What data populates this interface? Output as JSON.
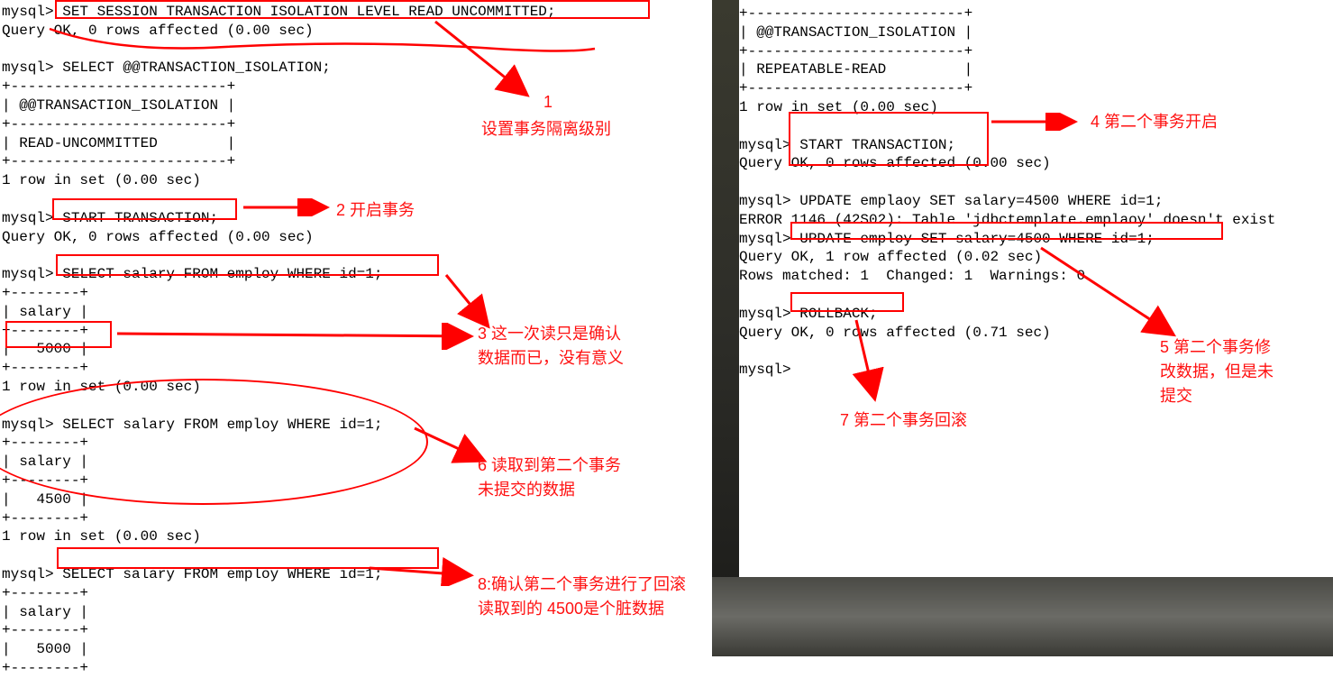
{
  "left": {
    "line1": "mysql> SET SESSION TRANSACTION ISOLATION LEVEL READ UNCOMMITTED;",
    "line2": "Query OK, 0 rows affected (0.00 sec)",
    "blank1": "",
    "line3": "mysql> SELECT @@TRANSACTION_ISOLATION;",
    "sep1": "+-------------------------+",
    "head1": "| @@TRANSACTION_ISOLATION |",
    "sep2": "+-------------------------+",
    "val1": "| READ-UNCOMMITTED        |",
    "sep3": "+-------------------------+",
    "row1": "1 row in set (0.00 sec)",
    "blank2": "",
    "line4": "mysql> START TRANSACTION;",
    "line5": "Query OK, 0 rows affected (0.00 sec)",
    "blank3": "",
    "line6": "mysql> SELECT salary FROM employ WHERE id=1;",
    "sep4": "+--------+",
    "head2": "| salary |",
    "sep5": "+--------+",
    "val2": "|   5000 |",
    "sep6": "+--------+",
    "row2": "1 row in set (0.00 sec)",
    "blank4": "",
    "line7": "mysql> SELECT salary FROM employ WHERE id=1;",
    "sep7": "+--------+",
    "head3": "| salary |",
    "sep8": "+--------+",
    "val3": "|   4500 |",
    "sep9": "+--------+",
    "row3": "1 row in set (0.00 sec)",
    "blank5": "",
    "line8": "mysql> SELECT salary FROM employ WHERE id=1;",
    "sep10": "+--------+",
    "head4": "| salary |",
    "sep11": "+--------+",
    "val4": "|   5000 |",
    "sep12": "+--------+"
  },
  "right": {
    "rtop": "+-------------------------+",
    "rh1": "| @@TRANSACTION_ISOLATION |",
    "rsep1": "+-------------------------+",
    "rv1": "| REPEATABLE-READ         |",
    "rsep2": "+-------------------------+",
    "rrow1": "1 row in set (0.00 sec)",
    "rblank1": "",
    "rline1": "mysql> START TRANSACTION;",
    "rline2": "Query OK, 0 rows affected (0.00 sec)",
    "rblank2": "",
    "rline3": "mysql> UPDATE emplaoy SET salary=4500 WHERE id=1;",
    "rerr": "ERROR 1146 (42S02): Table 'jdbctemplate.emplaoy' doesn't exist",
    "rline4": "mysql> UPDATE employ SET salary=4500 WHERE id=1;",
    "rline5": "Query OK, 1 row affected (0.02 sec)",
    "rline6": "Rows matched: 1  Changed: 1  Warnings: 0",
    "rblank3": "",
    "rline7": "mysql> ROLLBACK;",
    "rline8": "Query OK, 0 rows affected (0.71 sec)",
    "rblank4": "",
    "rline9": "mysql>"
  },
  "annotations": {
    "a1_num": "1",
    "a1_text": "设置事务隔离级别",
    "a2": "2 开启事务",
    "a3_line1": "3  这一次读只是确认",
    "a3_line2": "数据而已，没有意义",
    "a4": "4  第二个事务开启",
    "a5_line1": "5  第二个事务修",
    "a5_line2": "改数据，但是未",
    "a5_line3": "提交",
    "a6_line1": "6 读取到第二个事务",
    "a6_line2": "未提交的数据",
    "a7": "7  第二个事务回滚",
    "a8_line1": "8:确认第二个事务进行了回滚",
    "a8_line2": "读取到的 4500是个脏数据"
  }
}
